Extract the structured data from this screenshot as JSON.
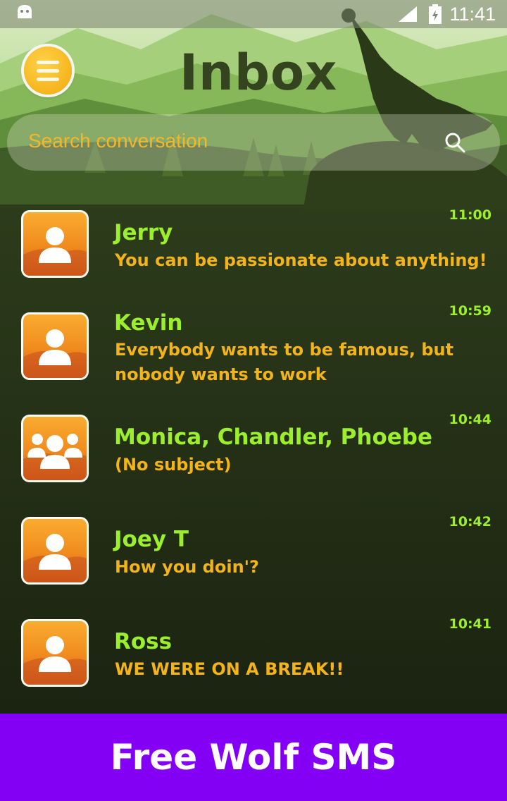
{
  "status_bar": {
    "time": "11:41"
  },
  "header": {
    "title": "Inbox"
  },
  "search": {
    "placeholder": "Search conversation"
  },
  "conversations": [
    {
      "name": "Jerry",
      "snippet": " You can be passionate about anything!",
      "time": "11:00",
      "avatar": "person-icon"
    },
    {
      "name": "Kevin",
      "snippet": " Everybody wants to be famous, but nobody wants to work",
      "time": "10:59",
      "avatar": "person-icon"
    },
    {
      "name": "Monica, Chandler, Phoebe",
      "snippet": "(No subject)",
      "time": "10:44",
      "avatar": "group-icon"
    },
    {
      "name": "Joey T",
      "snippet": "How you doin'?",
      "time": "10:42",
      "avatar": "person-icon"
    },
    {
      "name": "Ross",
      "snippet": "WE WERE ON A BREAK!!",
      "time": "10:41",
      "avatar": "person-icon"
    }
  ],
  "banner": {
    "text": "Free Wolf SMS"
  },
  "colors": {
    "name": "#9bef2d",
    "snippet": "#f3b31a",
    "banner": "#8400f5",
    "menu": "#f3a80a"
  }
}
